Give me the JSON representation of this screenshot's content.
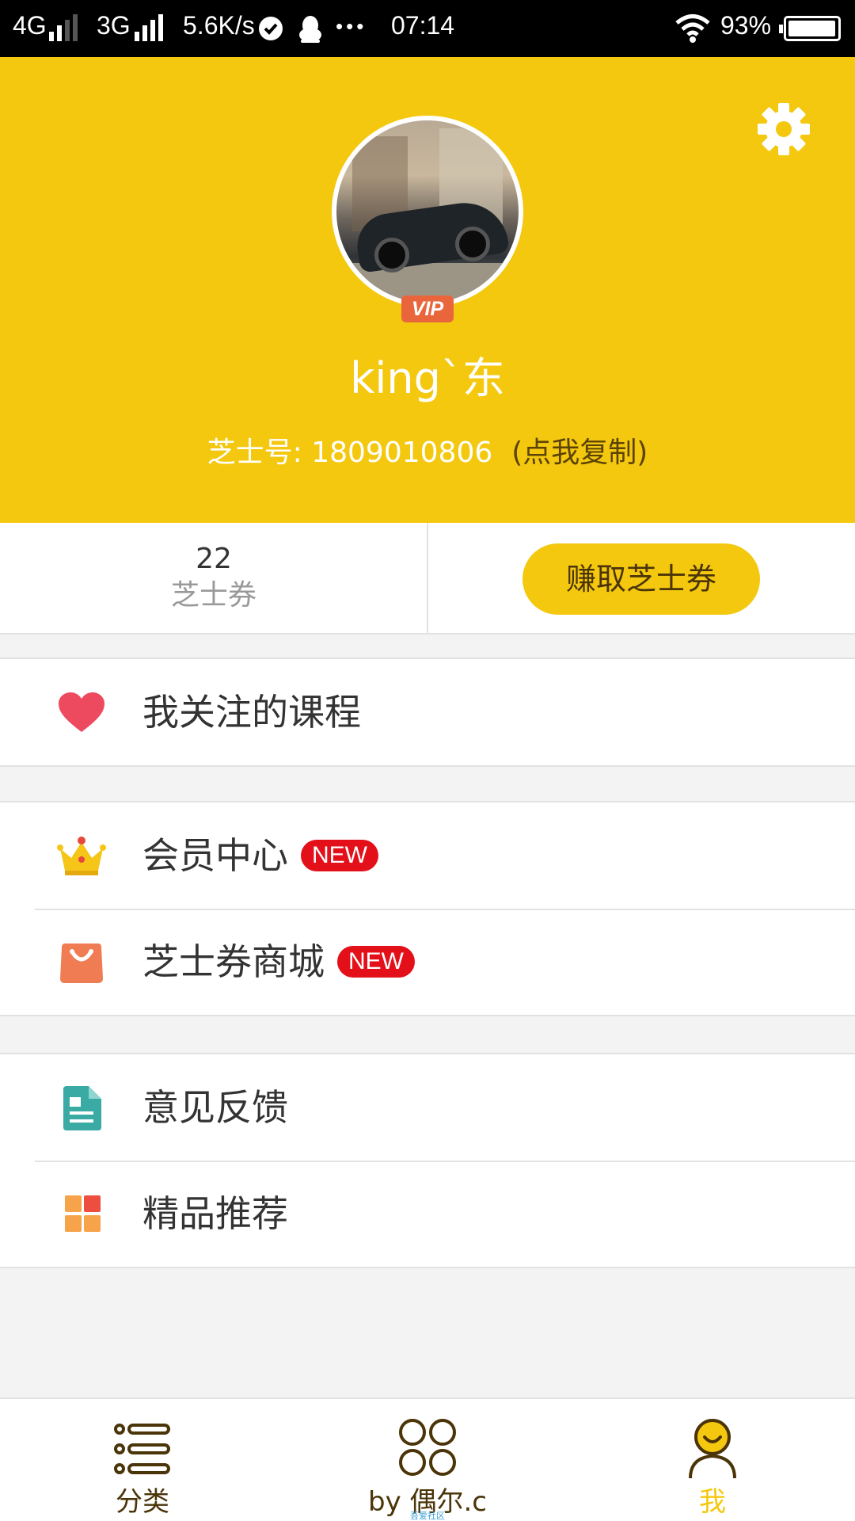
{
  "status_bar": {
    "network_1": "4G",
    "network_2": "3G",
    "speed": "5.6K/s",
    "ellipsis": "•••",
    "time": "07:14",
    "battery": "93%"
  },
  "header": {
    "avatar_badge": "VIP",
    "username": "king`东",
    "cheese_id_label": "芝士号: 1809010806",
    "copy_hint": "(点我复制)"
  },
  "stats": {
    "voucher_count": "22",
    "voucher_label": "芝士券",
    "earn_button": "赚取芝士券"
  },
  "menu": {
    "followed_courses": "我关注的课程",
    "member_center": "会员中心",
    "voucher_mall": "芝士券商城",
    "new_badge": "NEW",
    "feedback": "意见反馈",
    "recommended": "精品推荐"
  },
  "bottom_nav": {
    "categories": "分类",
    "center": "by 偶尔.c",
    "me": "我",
    "watermark": "吾爱社区"
  },
  "colors": {
    "brand_yellow": "#f4c80f",
    "dark_brown": "#4a3408",
    "badge_red": "#e3101a",
    "heart_red": "#ee4a5f",
    "vip_orange": "#e9663d"
  },
  "icons": {
    "settings": "gear-icon",
    "followed_courses": "heart-icon",
    "member_center": "crown-icon",
    "voucher_mall": "shopping-bag-icon",
    "feedback": "document-icon",
    "recommended": "grid-icon",
    "categories": "list-icon",
    "center": "four-circles-icon",
    "me": "user-icon"
  }
}
